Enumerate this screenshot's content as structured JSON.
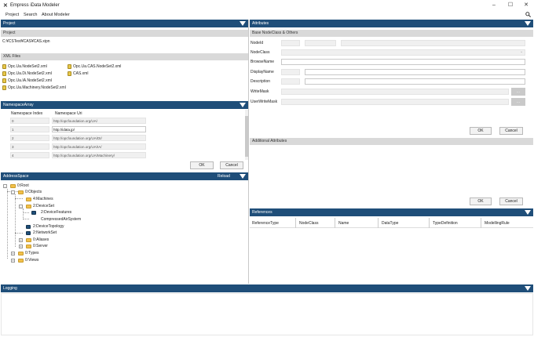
{
  "app": {
    "title": "Empress iData Modeler",
    "icon": "app-logo-icon"
  },
  "menu": [
    "Project",
    "Search",
    "About Modeler"
  ],
  "project_panel": {
    "header": "Project",
    "project_label": "Project",
    "project_path": "C:¥CSTest¥CAS¥CAS.xipn",
    "xml_label": "XML Files",
    "xml_files_col1": [
      "Opc.Ua.NodeSet2.xml",
      "Opc.Ua.Di.NodeSet2.xml",
      "Opc.Ua.IA.NodeSet2.xml",
      "Opc.Ua.Machinery.NodeSet2.xml"
    ],
    "xml_files_col2": [
      "Opc.Ua.CAS.NodeSet2.xml",
      "CAS.xml"
    ]
  },
  "namespace_panel": {
    "header": "NamespaceArray",
    "col_index": "Namespace Index",
    "col_uri": "Namespace Uri",
    "rows": [
      {
        "index": "0",
        "uri": "http://opcfoundation.org/UA/"
      },
      {
        "index": "1",
        "uri": "http://idata.jp/"
      },
      {
        "index": "2",
        "uri": "http://opcfoundation.org/UA/DI/"
      },
      {
        "index": "3",
        "uri": "http://opcfoundation.org/UA/IA/"
      },
      {
        "index": "4",
        "uri": "http://opcfoundation.org/UA/Machinery/"
      }
    ],
    "ok": "OK",
    "cancel": "Cancel"
  },
  "address_panel": {
    "header": "AddressSpace",
    "reload": "Reload",
    "tree": {
      "root": "0:Root",
      "objects": "0:Objects",
      "machines": "4:Machines",
      "deviceset": "2:DeviceSet",
      "devicefeatures": "2:DeviceFeatures",
      "compressedair": "CompressedAirSystem",
      "devicetopology": "2:DeviceTopology",
      "networkset": "2:NetworkSet",
      "aliases": "0:Aliases",
      "server": "0:Server",
      "types": "0:Types",
      "views": "0:Views"
    }
  },
  "attributes_panel": {
    "header": "Attributes",
    "base_label": "Base NodeClass & Others",
    "fields": [
      "NodeId",
      "NodeClass",
      "BrowseName",
      "DisplayName",
      "Description",
      "WriteMask",
      "UserWriteMask"
    ],
    "ellipsis": "...",
    "ok": "OK",
    "cancel": "Cancel",
    "additional_label": "Additional Attributes",
    "ok2": "OK",
    "cancel2": "Cancel"
  },
  "references_panel": {
    "header": "References",
    "columns": [
      "ReferenceType",
      "NodeClass",
      "Name",
      "DataType",
      "TypeDefinition",
      "ModellingRule"
    ]
  },
  "logging_panel": {
    "header": "Logging"
  },
  "colors": {
    "header": "#1f4e79",
    "subheader": "#d9d9d9"
  }
}
